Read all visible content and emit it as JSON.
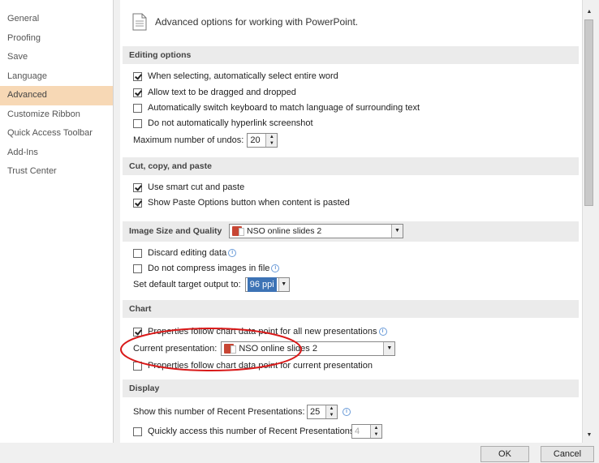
{
  "nav": {
    "items": [
      {
        "label": "General"
      },
      {
        "label": "Proofing"
      },
      {
        "label": "Save"
      },
      {
        "label": "Language"
      },
      {
        "label": "Advanced"
      },
      {
        "label": "Customize Ribbon"
      },
      {
        "label": "Quick Access Toolbar"
      },
      {
        "label": "Add-Ins"
      },
      {
        "label": "Trust Center"
      }
    ],
    "selected": "Advanced"
  },
  "header": {
    "title": "Advanced options for working with PowerPoint."
  },
  "editing": {
    "section_title": "Editing options",
    "auto_select_word": "When selecting, automatically select entire word",
    "drag_drop": "Allow text to be dragged and dropped",
    "switch_keyboard": "Automatically switch keyboard to match language of surrounding text",
    "no_hyperlink_screenshot": "Do not automatically hyperlink screenshot",
    "max_undos_label": "Maximum number of undos:",
    "max_undos_value": "20"
  },
  "cut_copy_paste": {
    "section_title": "Cut, copy, and paste",
    "smart_cut_paste": "Use smart cut and paste",
    "show_paste_options": "Show Paste Options button when content is pasted"
  },
  "image_size": {
    "section_title": "Image Size and Quality",
    "presentation_value": "NSO online slides 2",
    "discard_editing": "Discard editing data",
    "no_compress": "Do not compress images in file",
    "default_output_label": "Set default target output to:",
    "default_output_value": "96 ppi"
  },
  "chart": {
    "section_title": "Chart",
    "props_follow_all": "Properties follow chart data point for all new presentations",
    "current_presentation_label": "Current presentation:",
    "current_presentation_value": "NSO online slides 2",
    "props_follow_current": "Properties follow chart data point for current presentation"
  },
  "display": {
    "section_title": "Display",
    "recent_presentations_label": "Show this number of Recent Presentations:",
    "recent_presentations_value": "25",
    "quick_access_label": "Quickly access this number of Recent Presentations:",
    "quick_access_value": "4"
  },
  "buttons": {
    "ok": "OK",
    "cancel": "Cancel"
  },
  "colors": {
    "selected_nav": "#f7d8b5",
    "annotation": "#d91a1a",
    "highlight": "#3d73b5"
  }
}
